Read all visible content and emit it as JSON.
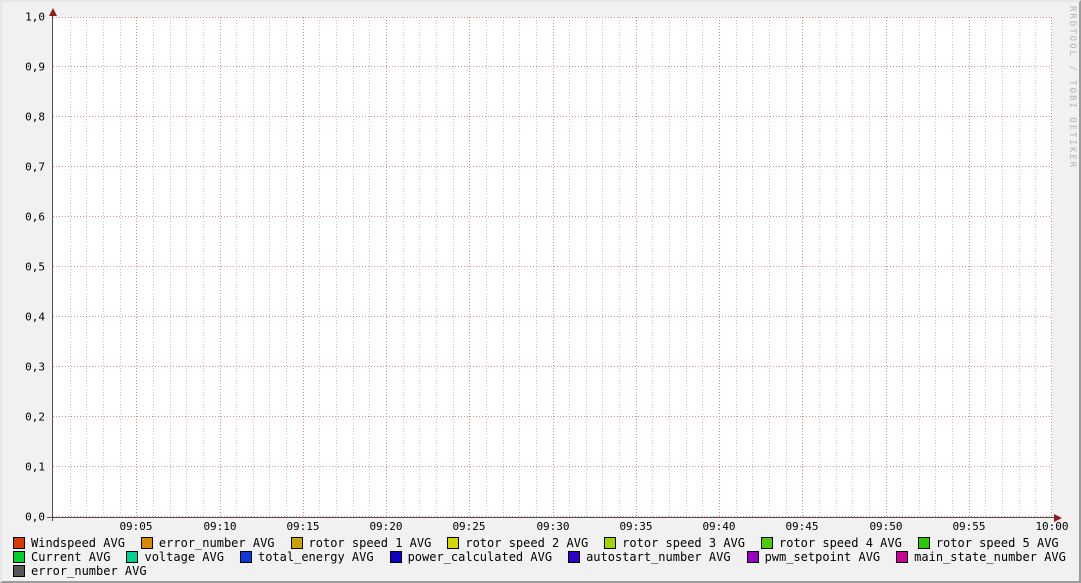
{
  "watermark": "RRDTOOL / TOBI OETIKER",
  "colors": {
    "background": "#f1f1f1",
    "canvas": "#ffffff",
    "grid_major": "#e08585",
    "grid_minor": "#c6c6c6",
    "axis": "#4f4f4f",
    "arrow": "#8f1d1d",
    "watermark_text": "#b3b3b3"
  },
  "chart_data": {
    "type": "line",
    "title": "",
    "xlabel": "",
    "ylabel": "",
    "ylim": [
      0.0,
      1.0
    ],
    "y_tick_step": 0.1,
    "y_tick_labels": [
      "0,0",
      "0,1",
      "0,2",
      "0,3",
      "0,4",
      "0,5",
      "0,6",
      "0,7",
      "0,8",
      "0,9",
      "1,0"
    ],
    "x_start_time": "09:00",
    "x_end_time": "10:00",
    "x_total_minutes": 60,
    "x_minor_step_minutes": 1,
    "x_major_step_minutes": 5,
    "x_tick_labels": [
      "09:05",
      "09:10",
      "09:15",
      "09:20",
      "09:25",
      "09:30",
      "09:35",
      "09:40",
      "09:45",
      "09:50",
      "09:55",
      "10:00"
    ],
    "grid": true,
    "legend_position": "bottom",
    "plotted_points": "none (empty graph, no data drawn)",
    "series": [
      {
        "label": "Windspeed AVG",
        "color": "#d83a01",
        "values": []
      },
      {
        "label": "error_number AVG",
        "color": "#d88a01",
        "values": []
      },
      {
        "label": "rotor speed 1 AVG",
        "color": "#c9a301",
        "values": []
      },
      {
        "label": "rotor speed 2 AVG",
        "color": "#d3d601",
        "values": []
      },
      {
        "label": "rotor speed 3 AVG",
        "color": "#a3d301",
        "values": []
      },
      {
        "label": "rotor speed 4 AVG",
        "color": "#4ccc0d",
        "values": []
      },
      {
        "label": "rotor speed 5 AVG",
        "color": "#2bc801",
        "values": []
      },
      {
        "label": "Current AVG",
        "color": "#01d22b",
        "values": []
      },
      {
        "label": "voltage AVG",
        "color": "#01d093",
        "values": []
      },
      {
        "label": "total_energy AVG",
        "color": "#0b3ad6",
        "values": []
      },
      {
        "label": "power_calculated AVG",
        "color": "#0d01c6",
        "values": []
      },
      {
        "label": "autostart_number AVG",
        "color": "#2e01c9",
        "values": []
      },
      {
        "label": "pwm_setpoint AVG",
        "color": "#9a01c6",
        "values": []
      },
      {
        "label": "main_state_number AVG",
        "color": "#cb0196",
        "values": []
      },
      {
        "label": "error_number AVG",
        "color": "#565656",
        "values": []
      }
    ],
    "legend_rows": [
      7,
      7,
      1
    ]
  }
}
